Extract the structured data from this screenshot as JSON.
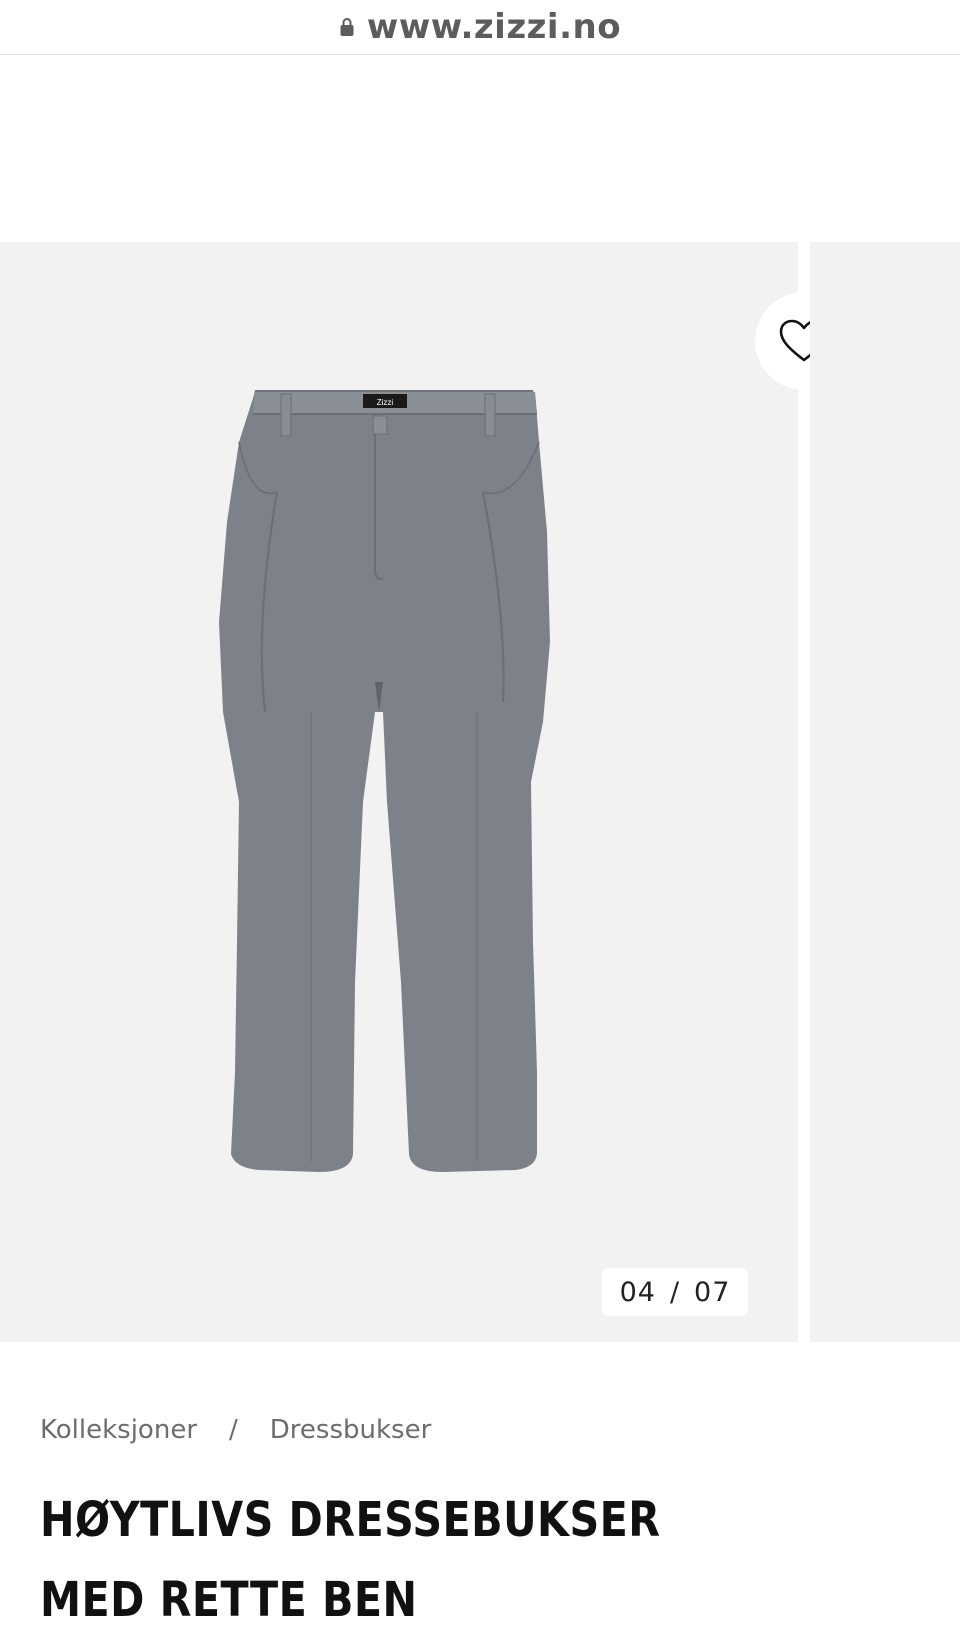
{
  "browser": {
    "url": "www.zizzi.no",
    "lock_icon": "lock-icon"
  },
  "gallery": {
    "current": "04",
    "separator": "/",
    "total": "07",
    "favorite_icon": "heart-icon",
    "image_label": "Zizzi"
  },
  "breadcrumb": {
    "items": [
      "Kolleksjoner",
      "Dressbukser"
    ],
    "separator": "/"
  },
  "product": {
    "title": "HØYTLIVS DRESSEBUKSER MED RETTE BEN"
  },
  "colors": {
    "gallery_bg": "#f2f2f2",
    "text_dark": "#111111",
    "text_muted": "#6d6d6d",
    "trouser_grey": "#7d8189"
  }
}
